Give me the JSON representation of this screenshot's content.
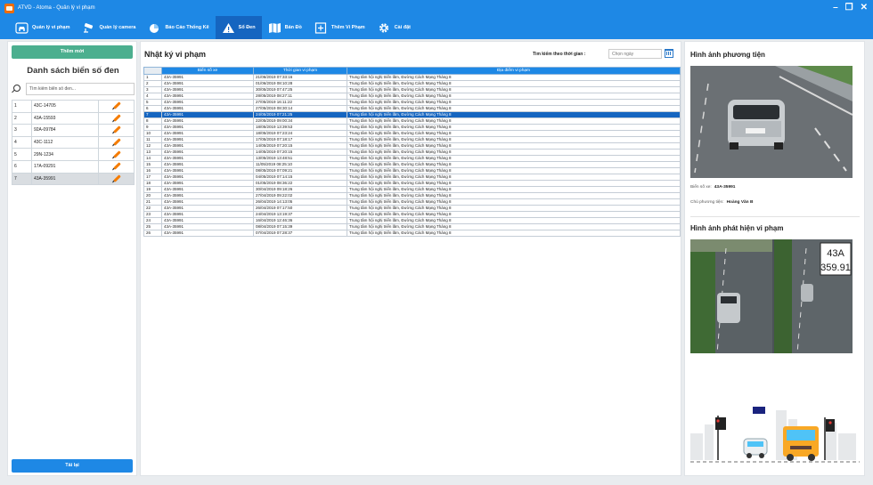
{
  "window": {
    "logo": "ATVD",
    "title": "ATVD - Atoma - Quản lý vi phạm",
    "controls": [
      "–",
      "❐",
      "✕"
    ]
  },
  "nav": [
    {
      "id": "vehicles",
      "label": "Quản lý vi phạm",
      "icon": "car-icon"
    },
    {
      "id": "cameras",
      "label": "Quản lý camera",
      "icon": "cctv-icon"
    },
    {
      "id": "reports",
      "label": "Báo Cáo Thống Kê",
      "icon": "pie-chart-icon"
    },
    {
      "id": "blacklist",
      "label": "Sổ Đen",
      "icon": "warning-icon",
      "active": true
    },
    {
      "id": "map",
      "label": "Bản Đồ",
      "icon": "map-icon"
    },
    {
      "id": "add_violation",
      "label": "Thêm Vi Phạm",
      "icon": "plus-box-icon"
    },
    {
      "id": "settings",
      "label": "Cài đặt",
      "icon": "gear-icon"
    }
  ],
  "left": {
    "add_label": "Thêm mới",
    "title": "Danh sách biển số đen",
    "search_placeholder": "Tìm kiếm biển số đen...",
    "plates": [
      {
        "n": "1",
        "plate": "43C-14705"
      },
      {
        "n": "2",
        "plate": "43A-15593"
      },
      {
        "n": "3",
        "plate": "92A-09784"
      },
      {
        "n": "4",
        "plate": "43C-1112"
      },
      {
        "n": "5",
        "plate": "29N-1234"
      },
      {
        "n": "6",
        "plate": "17A-09291"
      },
      {
        "n": "7",
        "plate": "43A-35991",
        "selected": true
      }
    ],
    "reload_label": "Tải lại"
  },
  "center": {
    "title": "Nhật ký vi phạm",
    "time_search_label": "Tìm kiếm theo thời gian :",
    "time_placeholder": "Chọn ngày",
    "columns": [
      "Biển số xe",
      "Thời gian vi phạm",
      "Địa điểm vi phạm"
    ],
    "selected_row": 7,
    "rows": [
      [
        "1",
        "43A-35991",
        "21/06/2019 07:33:16",
        "Trung tâm hội nghị triển lãm, Đường Cách Mạng Tháng 8"
      ],
      [
        "2",
        "43A-35991",
        "01/06/2019 08:10:28",
        "Trung tâm hội nghị triển lãm, Đường Cách Mạng Tháng 8"
      ],
      [
        "3",
        "43A-35991",
        "30/05/2019 07:47:25",
        "Trung tâm hội nghị triển lãm, Đường Cách Mạng Tháng 8"
      ],
      [
        "4",
        "43A-35991",
        "28/05/2019 08:27:11",
        "Trung tâm hội nghị triển lãm, Đường Cách Mạng Tháng 8"
      ],
      [
        "5",
        "43A-35991",
        "27/05/2019 16:11:22",
        "Trung tâm hội nghị triển lãm, Đường Cách Mạng Tháng 8"
      ],
      [
        "6",
        "43A-35991",
        "27/05/2019 08:30:14",
        "Trung tâm hội nghị triển lãm, Đường Cách Mạng Tháng 8"
      ],
      [
        "7",
        "43A-35991",
        "24/05/2019 07:21:25",
        "Trung tâm hội nghị triển lãm, Đường Cách Mạng Tháng 8"
      ],
      [
        "8",
        "43A-35991",
        "22/05/2019 09:00:34",
        "Trung tâm hội nghị triển lãm, Đường Cách Mạng Tháng 8"
      ],
      [
        "9",
        "43A-35991",
        "18/05/2019 13:39:53",
        "Trung tâm hội nghị triển lãm, Đường Cách Mạng Tháng 8"
      ],
      [
        "10",
        "43A-35991",
        "18/05/2019 07:23:24",
        "Trung tâm hội nghị triển lãm, Đường Cách Mạng Tháng 8"
      ],
      [
        "11",
        "43A-35991",
        "17/05/2019 07:18:17",
        "Trung tâm hội nghị triển lãm, Đường Cách Mạng Tháng 8"
      ],
      [
        "12",
        "43A-35991",
        "14/05/2019 07:20:15",
        "Trung tâm hội nghị triển lãm, Đường Cách Mạng Tháng 8"
      ],
      [
        "13",
        "43A-35991",
        "14/05/2019 07:20:15",
        "Trung tâm hội nghị triển lãm, Đường Cách Mạng Tháng 8"
      ],
      [
        "14",
        "43A-35991",
        "13/05/2019 13:48:51",
        "Trung tâm hội nghị triển lãm, Đường Cách Mạng Tháng 8"
      ],
      [
        "15",
        "43A-35991",
        "11/05/2019 08:25:10",
        "Trung tâm hội nghị triển lãm, Đường Cách Mạng Tháng 8"
      ],
      [
        "16",
        "43A-35991",
        "08/05/2019 07:09:21",
        "Trung tâm hội nghị triển lãm, Đường Cách Mạng Tháng 8"
      ],
      [
        "17",
        "43A-35991",
        "04/05/2019 07:14:15",
        "Trung tâm hội nghị triển lãm, Đường Cách Mạng Tháng 8"
      ],
      [
        "18",
        "43A-35991",
        "01/05/2019 08:36:22",
        "Trung tâm hội nghị triển lãm, Đường Cách Mạng Tháng 8"
      ],
      [
        "19",
        "43A-35991",
        "30/04/2019 09:18:26",
        "Trung tâm hội nghị triển lãm, Đường Cách Mạng Tháng 8"
      ],
      [
        "20",
        "43A-35991",
        "27/04/2019 09:22:02",
        "Trung tâm hội nghị triển lãm, Đường Cách Mạng Tháng 8"
      ],
      [
        "21",
        "43A-35991",
        "26/04/2019 14:13:05",
        "Trung tâm hội nghị triển lãm, Đường Cách Mạng Tháng 8"
      ],
      [
        "22",
        "43A-35991",
        "26/04/2019 07:17:50",
        "Trung tâm hội nghị triển lãm, Đường Cách Mạng Tháng 8"
      ],
      [
        "23",
        "43A-35991",
        "24/04/2019 13:19:37",
        "Trung tâm hội nghị triển lãm, Đường Cách Mạng Tháng 8"
      ],
      [
        "24",
        "43A-35991",
        "16/04/2019 12:46:36",
        "Trung tâm hội nghị triển lãm, Đường Cách Mạng Tháng 8"
      ],
      [
        "25",
        "43A-35991",
        "08/04/2019 07:15:39",
        "Trung tâm hội nghị triển lãm, Đường Cách Mạng Tháng 8"
      ],
      [
        "26",
        "43A-35991",
        "07/04/2019 07:28:37",
        "Trung tâm hội nghị triển lãm, Đường Cách Mạng Tháng 8"
      ]
    ]
  },
  "right": {
    "vehicle_image_title": "Hình ảnh phương tiện",
    "plate_label": "Biển số xe:",
    "plate_value": "43A-35991",
    "owner_label": "Chủ phương tiện:",
    "owner_value": "Hoàng Văn B",
    "violation_image_title": "Hình ảnh phát hiện vi phạm",
    "plate_crop_line1": "43A",
    "plate_crop_line2": "359.91"
  },
  "colors": {
    "primary": "#1e88e5",
    "nav_active": "#1565c0",
    "add_button": "#4caf8f",
    "selected_row": "#1565c0",
    "edit_icon": "#f57c00"
  }
}
